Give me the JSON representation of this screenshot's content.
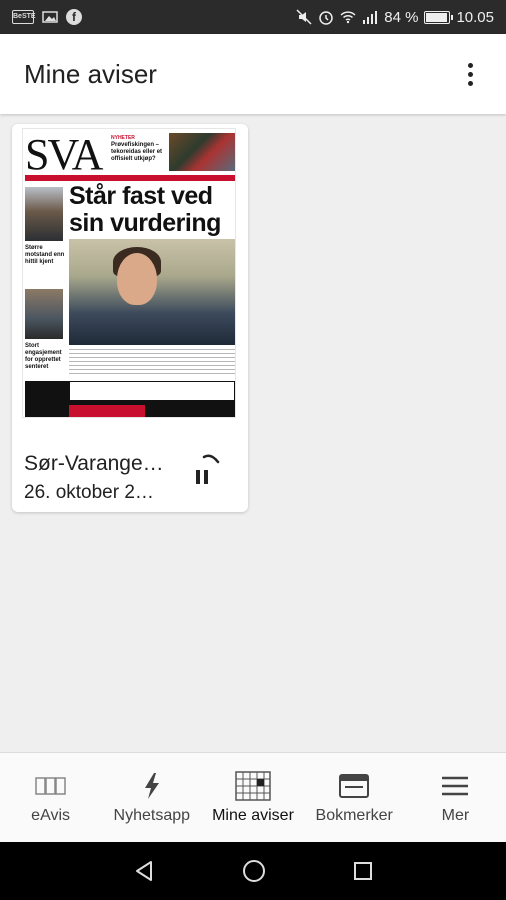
{
  "status_bar": {
    "left_badge": "BeSTE",
    "battery": "84 %",
    "time": "10.05"
  },
  "app_bar": {
    "title": "Mine aviser"
  },
  "newspaper_card": {
    "cover": {
      "masthead": "SVA",
      "teaser_kicker": "NYHETER",
      "teaser": "Prøvefiskingen – tekoreidas eller et offisielt utkjøp?",
      "headline": "Står fast ved sin vurdering",
      "side_story_1": "Større motstand enn hittil kjent",
      "side_story_2": "Stort engasjement for opprettet senteret"
    },
    "title": "Sør-Varange…",
    "date": "26. oktober 2…",
    "download_progress": 0.15
  },
  "bottom_nav": {
    "items": [
      {
        "label": "eAvis",
        "icon": "eavis-pages-icon"
      },
      {
        "label": "Nyhetsapp",
        "icon": "lightning-icon"
      },
      {
        "label": "Mine aviser",
        "icon": "grid-calendar-icon",
        "active": true
      },
      {
        "label": "Bokmerker",
        "icon": "bookmark-window-icon"
      },
      {
        "label": "Mer",
        "icon": "hamburger-menu-icon"
      }
    ]
  },
  "colors": {
    "status_bar_bg": "#2b2b2b",
    "app_bar_bg": "#ffffff",
    "content_bg": "#efefef",
    "accent_red": "#c8102e",
    "system_nav_bg": "#000000"
  }
}
